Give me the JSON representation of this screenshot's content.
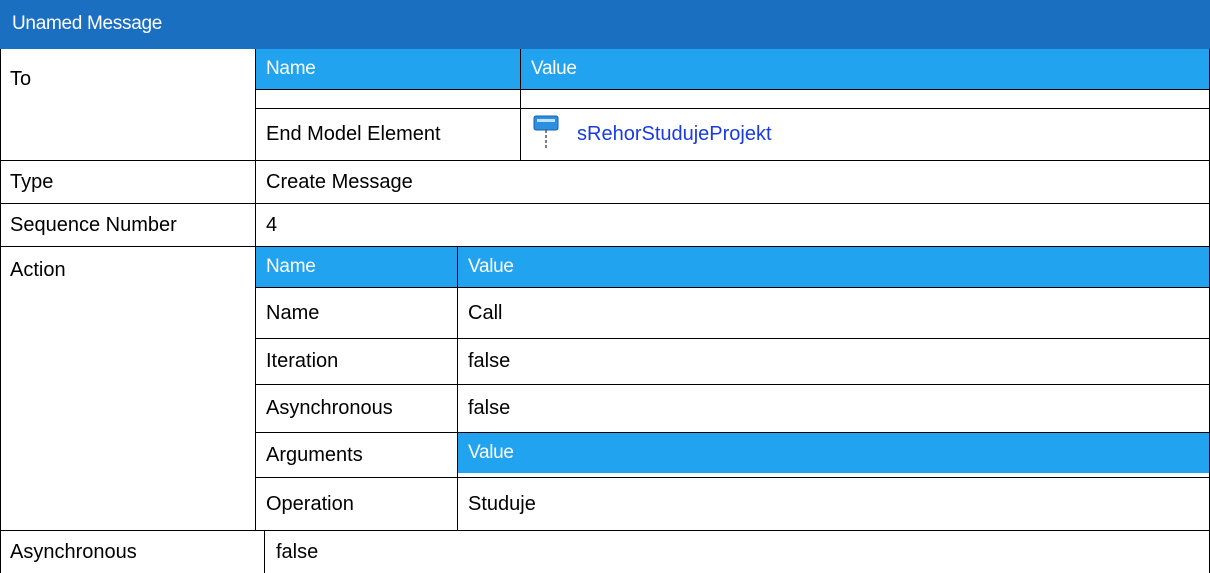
{
  "title": "Unamed Message",
  "to": {
    "label": "To",
    "header_name": "Name",
    "header_value": "Value",
    "row_name": "End Model Element",
    "row_value": "sRehorStudujeProjekt",
    "row_icon": "lifeline-icon"
  },
  "type": {
    "label": "Type",
    "value": "Create Message"
  },
  "sequence": {
    "label": "Sequence Number",
    "value": "4"
  },
  "action": {
    "label": "Action",
    "header_name": "Name",
    "header_value": "Value",
    "rows": [
      {
        "name": "Name",
        "value": "Call"
      },
      {
        "name": "Iteration",
        "value": "false"
      },
      {
        "name": "Asynchronous",
        "value": "false"
      },
      {
        "name": "Arguments",
        "value": "Value"
      },
      {
        "name": "Operation",
        "value": "Studuje"
      }
    ]
  },
  "asynchronous": {
    "label": "Asynchronous",
    "value": "false"
  },
  "colors": {
    "title_bg": "#1a6fc0",
    "header_bg": "#22a3ef",
    "link": "#1a3be0"
  }
}
